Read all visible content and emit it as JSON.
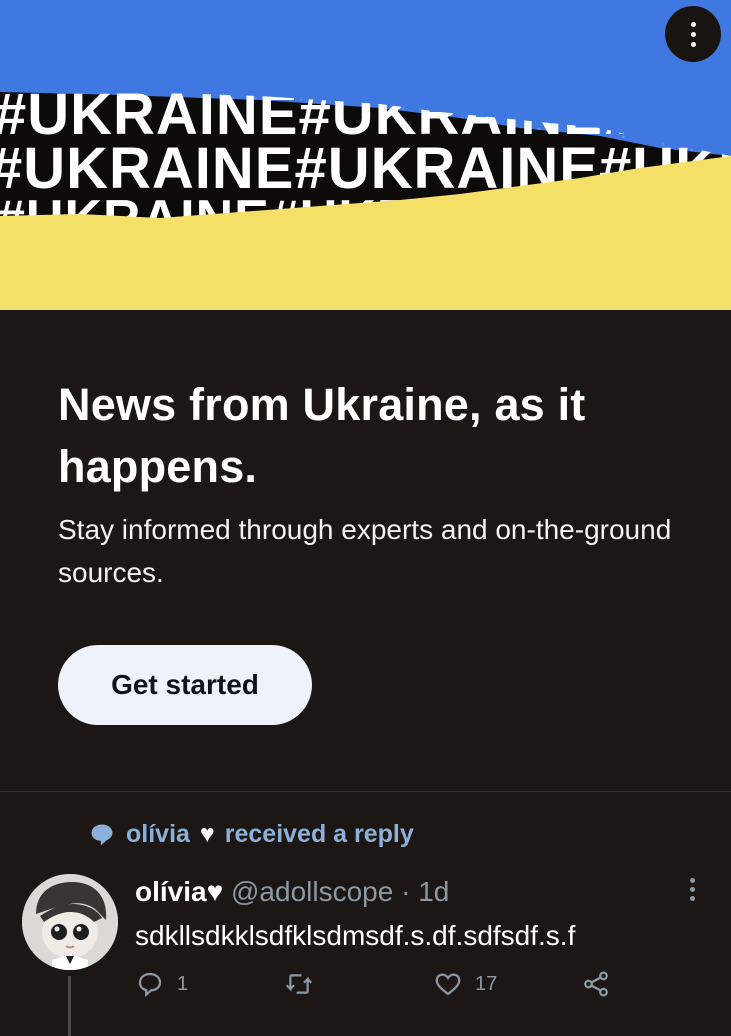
{
  "banner": {
    "hashtag_text": "#UKRAINE#UKRAINE#UKRAINE",
    "colors": {
      "blue": "#3f78e0",
      "yellow": "#f5e067",
      "black": "#0d0b09"
    },
    "menu_icon": "more-vertical-icon"
  },
  "promo": {
    "title": "News from Ukraine, as it happens.",
    "subtitle": "Stay informed through experts and on-the-ground sources.",
    "cta_label": "Get started"
  },
  "social_context": {
    "icon": "speech-bubble-icon",
    "name": "olívia",
    "suffix": "received a reply"
  },
  "tweet": {
    "display_name": "olívia",
    "handle": "@adollscope",
    "separator": "·",
    "time": "1d",
    "text": "sdkllsdkklsdfklsdmsdf.s.df.sdfsdf.s.f",
    "reply_count": "1",
    "retweet_count": "",
    "like_count": "17"
  }
}
